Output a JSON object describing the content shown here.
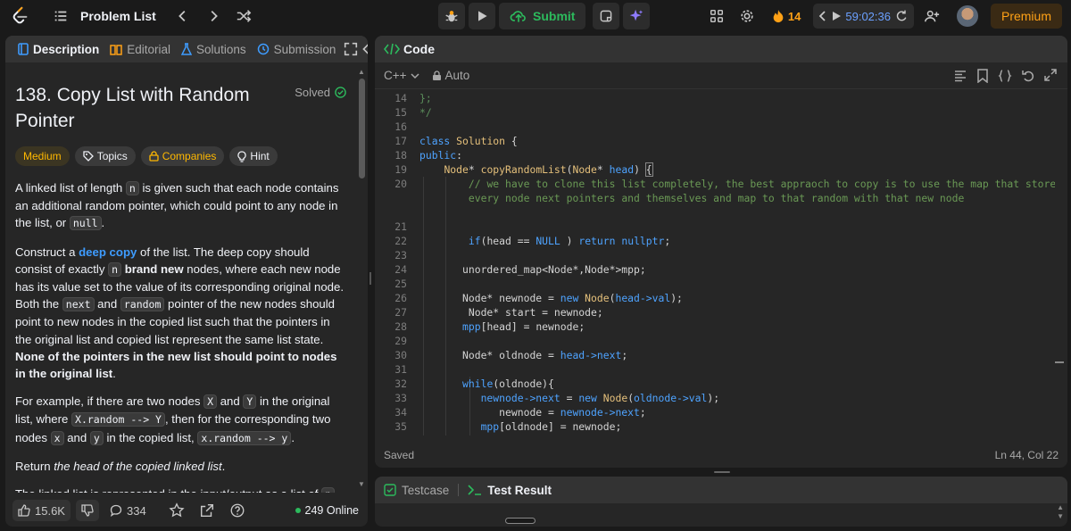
{
  "topbar": {
    "problem_list": "Problem List",
    "submit": "Submit",
    "streak": "14",
    "timer": "59:02:36",
    "premium": "Premium"
  },
  "left": {
    "tabs": [
      "Description",
      "Editorial",
      "Solutions",
      "Submission"
    ],
    "title": "138. Copy List with Random Pointer",
    "solved": "Solved",
    "chips": [
      "Medium",
      "Topics",
      "Companies",
      "Hint"
    ],
    "footer": {
      "likes": "15.6K",
      "comments": "334",
      "online": "249 Online"
    }
  },
  "code": {
    "header": "Code",
    "language": "C++",
    "mode": "Auto",
    "status": "Saved",
    "cursor": "Ln 44, Col 22"
  },
  "bottom": {
    "testcase": "Testcase",
    "test_result": "Test Result"
  },
  "colors": {
    "accent": "#ffa116",
    "green": "#2cbb5d",
    "blue": "#3e9cff",
    "bg": "#1a1a1a",
    "panel": "#262626"
  }
}
